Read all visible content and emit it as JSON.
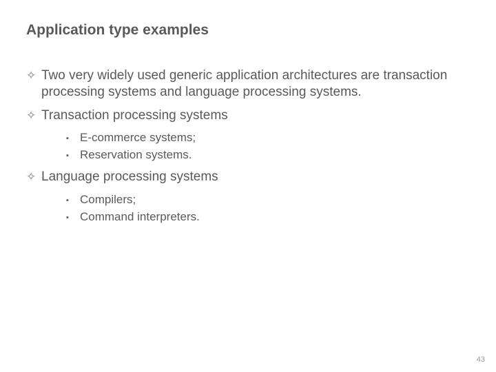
{
  "title": "Application type examples",
  "bullets": [
    {
      "text": "Two very widely used generic application architectures are transaction processing systems and language processing systems.",
      "children": []
    },
    {
      "text": "Transaction processing systems",
      "children": [
        "E-commerce systems;",
        "Reservation systems."
      ]
    },
    {
      "text": "Language processing systems",
      "children": [
        "Compilers;",
        "Command interpreters."
      ]
    }
  ],
  "markers": {
    "l1": "✧",
    "l2": "▪"
  },
  "page_number": "43"
}
